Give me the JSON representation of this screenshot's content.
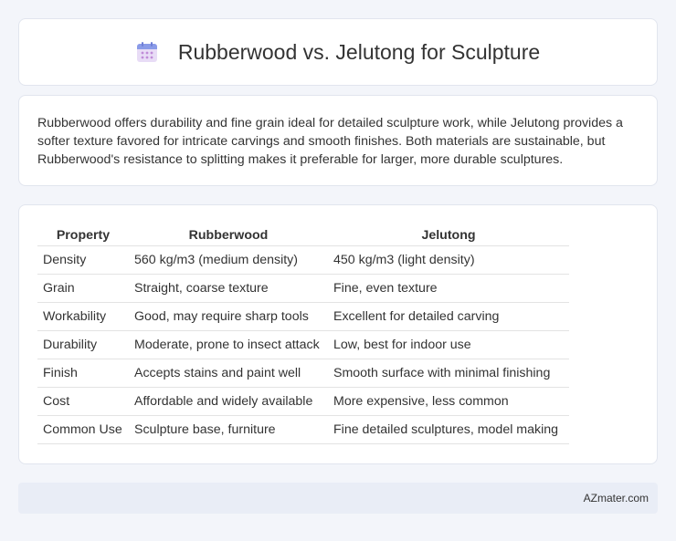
{
  "header": {
    "title": "Rubberwood vs. Jelutong for Sculpture",
    "icon": "calendar-icon"
  },
  "summary": {
    "text": "Rubberwood offers durability and fine grain ideal for detailed sculpture work, while Jelutong provides a softer texture favored for intricate carvings and smooth finishes. Both materials are sustainable, but Rubberwood's resistance to splitting makes it preferable for larger, more durable sculptures."
  },
  "table": {
    "headers": [
      "Property",
      "Rubberwood",
      "Jelutong"
    ],
    "rows": [
      [
        "Density",
        "560 kg/m3 (medium density)",
        "450 kg/m3 (light density)"
      ],
      [
        "Grain",
        "Straight, coarse texture",
        "Fine, even texture"
      ],
      [
        "Workability",
        "Good, may require sharp tools",
        "Excellent for detailed carving"
      ],
      [
        "Durability",
        "Moderate, prone to insect attack",
        "Low, best for indoor use"
      ],
      [
        "Finish",
        "Accepts stains and paint well",
        "Smooth surface with minimal finishing"
      ],
      [
        "Cost",
        "Affordable and widely available",
        "More expensive, less common"
      ],
      [
        "Common Use",
        "Sculpture base, furniture",
        "Fine detailed sculptures, model making"
      ]
    ]
  },
  "footer": {
    "text": "AZmater.com"
  }
}
